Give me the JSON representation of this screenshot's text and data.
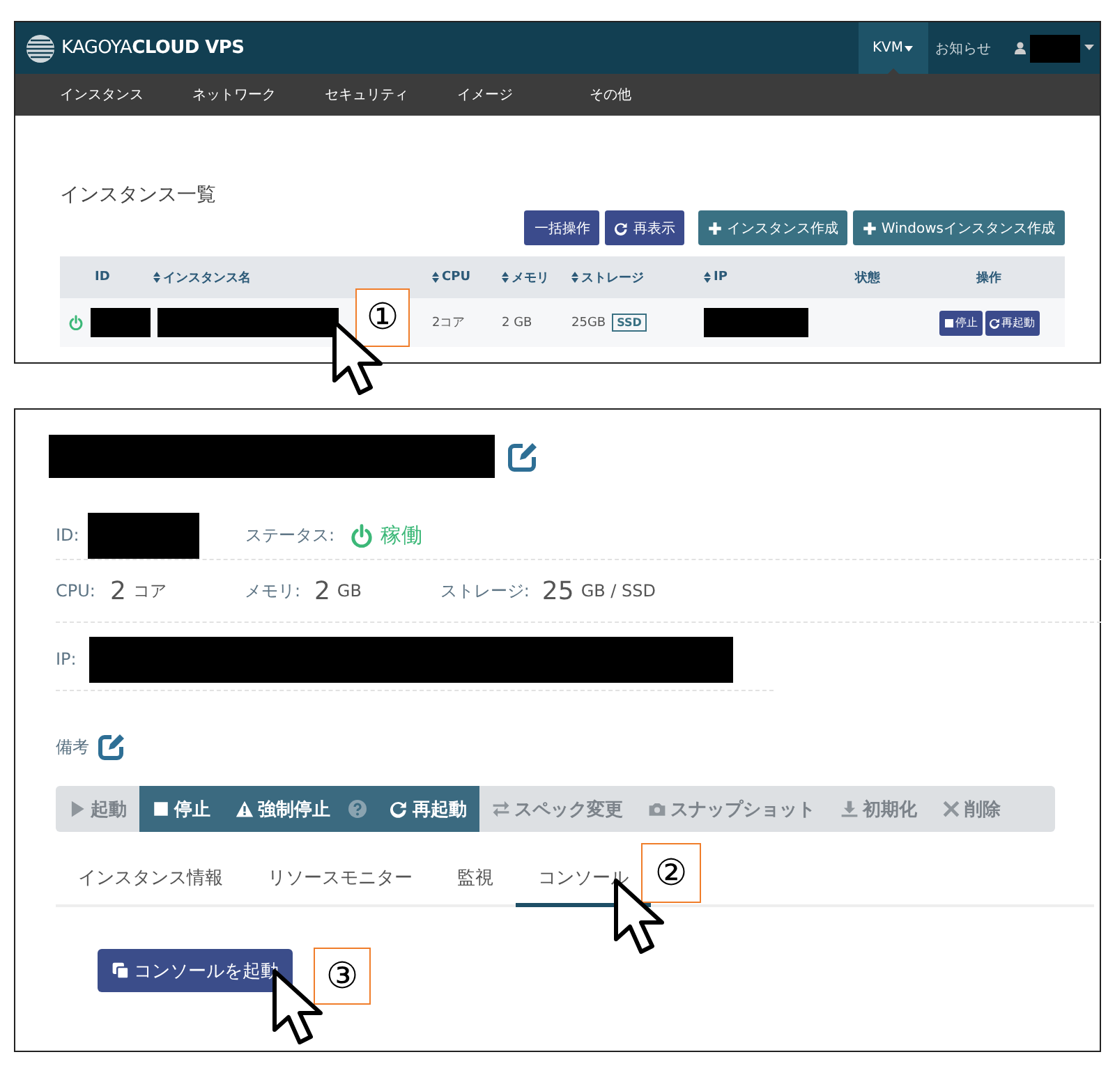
{
  "panel_top": {
    "brand": "KAGOYA**CLOUD VPS**",
    "header_menu": [
      {
        "label": "KVM",
        "selected": true,
        "dropdown": true
      },
      {
        "label": "お知らせ",
        "selected": false,
        "dropdown": false
      }
    ],
    "nav": [
      "インスタンス",
      "ネットワーク",
      "セキュリティ",
      "イメージ",
      "その他"
    ],
    "heading": "インスタンス一覧",
    "actions": [
      {
        "label": "一括操作",
        "kind": "primary"
      },
      {
        "label": "再表示",
        "kind": "primary"
      },
      {
        "label": "インスタンス作成",
        "kind": "create"
      },
      {
        "label": "Windowsインスタンス作成",
        "kind": "create"
      }
    ],
    "table": {
      "columns": [
        {
          "label": "ID",
          "sortable": false
        },
        {
          "label": "インスタンス名",
          "sortable": true
        },
        {
          "label": "CPU",
          "sortable": true
        },
        {
          "label": "メモリ",
          "sortable": true
        },
        {
          "label": "ストレージ",
          "sortable": true
        },
        {
          "label": "IP",
          "sortable": true
        },
        {
          "label": "状態",
          "sortable": false
        },
        {
          "label": "操作",
          "sortable": false
        }
      ],
      "rows": [
        {
          "power_on": true,
          "cpu": "2コア",
          "memory": "2 GB",
          "storage": "25GB",
          "storage_type": "SSD",
          "actions": [
            "停止",
            "再起動"
          ]
        }
      ]
    },
    "callout": "①"
  },
  "panel_detail": {
    "status": {
      "label": "ステータス:",
      "value": "稼働",
      "running": true
    },
    "id_label": "ID:",
    "specs": [
      {
        "label": "CPU:",
        "value": "2",
        "unit": "コア"
      },
      {
        "label": "メモリ:",
        "value": "2",
        "unit": "GB"
      },
      {
        "label": "ストレージ:",
        "value": "25",
        "unit": "GB / SSD"
      }
    ],
    "ip_label": "IP:",
    "note_label": "備考",
    "action_bar": [
      {
        "label": "起動",
        "enabled": false,
        "help": false
      },
      {
        "label": "停止",
        "enabled": true,
        "help": false
      },
      {
        "label": "強制停止",
        "enabled": true,
        "help": true
      },
      {
        "label": "再起動",
        "enabled": true,
        "help": false
      },
      {
        "label": "スペック変更",
        "enabled": false,
        "help": false
      },
      {
        "label": "スナップショット",
        "enabled": false,
        "help": false
      },
      {
        "label": "初期化",
        "enabled": false,
        "help": false
      },
      {
        "label": "削除",
        "enabled": false,
        "help": false
      }
    ],
    "tabs": [
      {
        "label": "インスタンス情報",
        "selected": false
      },
      {
        "label": "リソースモニター",
        "selected": false
      },
      {
        "label": "監視",
        "selected": false
      },
      {
        "label": "コンソール",
        "selected": true
      }
    ],
    "tab_callout": "②",
    "console_button": "コンソールを起動",
    "button_callout": "③"
  }
}
